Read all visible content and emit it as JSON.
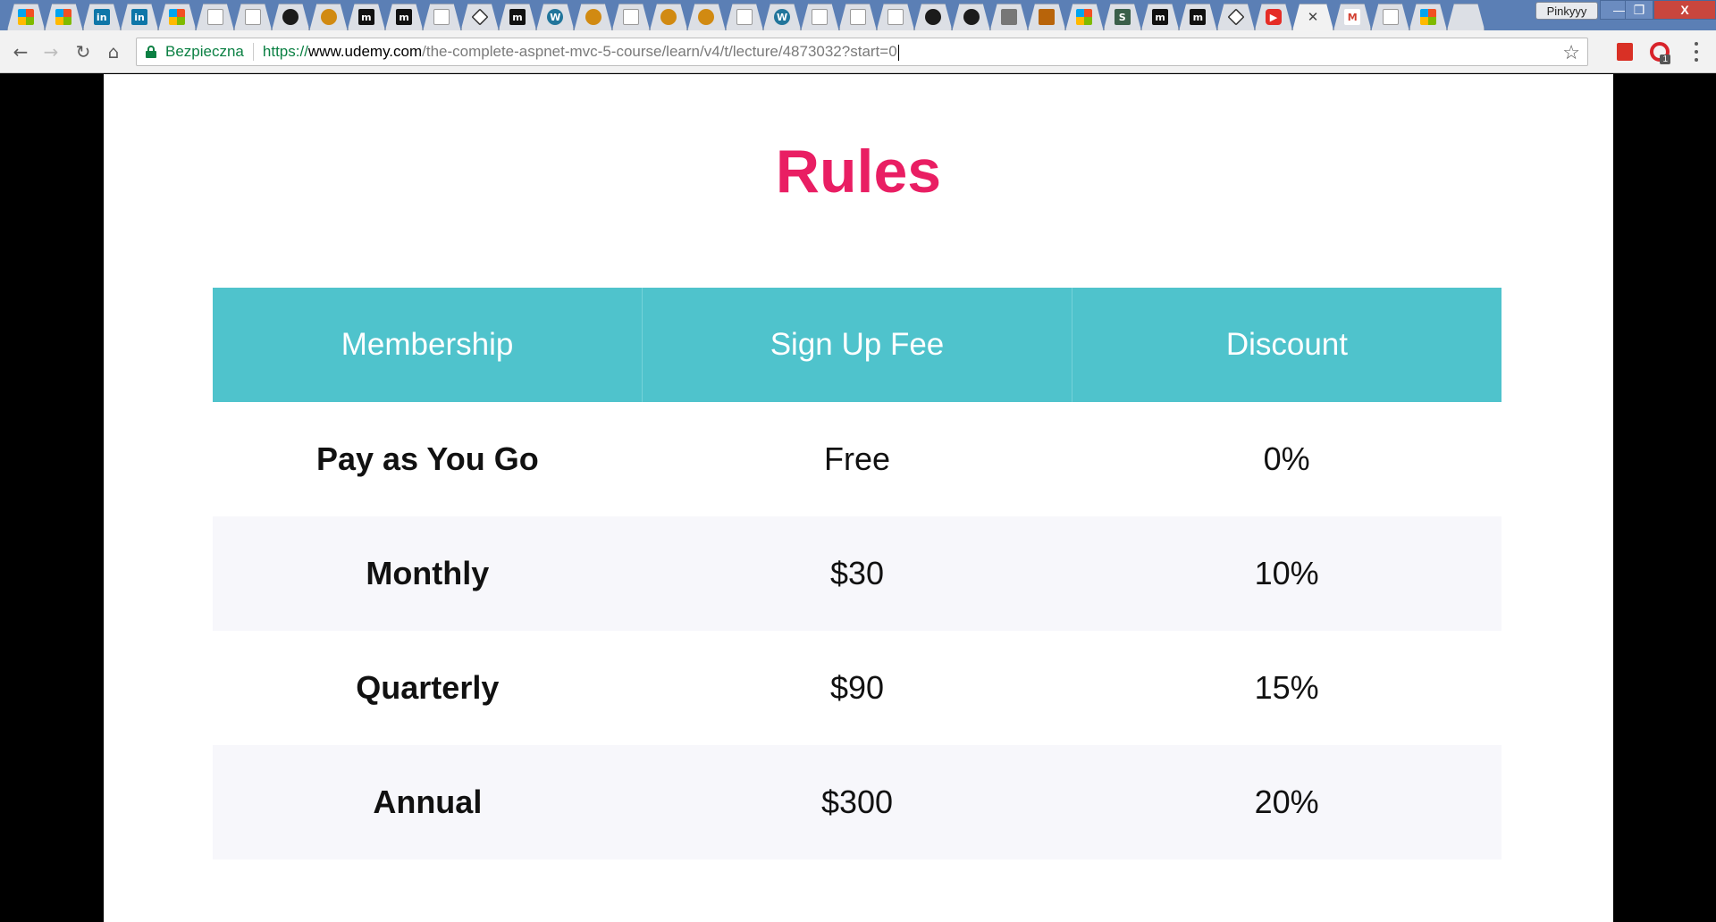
{
  "browser": {
    "tabs": [
      {
        "icon": "microsoft-icon",
        "glyph": ""
      },
      {
        "icon": "microsoft-icon",
        "glyph": ""
      },
      {
        "icon": "linkedin-icon",
        "glyph": "in"
      },
      {
        "icon": "linkedin-icon",
        "glyph": "in"
      },
      {
        "icon": "microsoft-icon",
        "glyph": ""
      },
      {
        "icon": "document-icon",
        "glyph": ""
      },
      {
        "icon": "document-icon",
        "glyph": ""
      },
      {
        "icon": "github-icon",
        "glyph": ""
      },
      {
        "icon": "lion-icon",
        "glyph": ""
      },
      {
        "icon": "m-icon",
        "glyph": "m"
      },
      {
        "icon": "m-icon",
        "glyph": "m"
      },
      {
        "icon": "document-icon",
        "glyph": ""
      },
      {
        "icon": "diamond-icon",
        "glyph": ""
      },
      {
        "icon": "m-icon",
        "glyph": "m"
      },
      {
        "icon": "wordpress-icon",
        "glyph": "W"
      },
      {
        "icon": "lion-icon",
        "glyph": ""
      },
      {
        "icon": "document-icon",
        "glyph": ""
      },
      {
        "icon": "lion-icon",
        "glyph": ""
      },
      {
        "icon": "lion-icon",
        "glyph": ""
      },
      {
        "icon": "document-icon",
        "glyph": ""
      },
      {
        "icon": "wordpress-icon",
        "glyph": "W"
      },
      {
        "icon": "document-icon",
        "glyph": ""
      },
      {
        "icon": "document-icon",
        "glyph": ""
      },
      {
        "icon": "cake-icon",
        "glyph": ""
      },
      {
        "icon": "github-icon",
        "glyph": ""
      },
      {
        "icon": "github-icon",
        "glyph": ""
      },
      {
        "icon": "gray-grid-icon",
        "glyph": ""
      },
      {
        "icon": "gold-icon",
        "glyph": ""
      },
      {
        "icon": "microsoft-icon",
        "glyph": ""
      },
      {
        "icon": "s-icon",
        "glyph": "S"
      },
      {
        "icon": "m-icon",
        "glyph": "m"
      },
      {
        "icon": "m-icon",
        "glyph": "m"
      },
      {
        "icon": "diamond-icon",
        "glyph": ""
      },
      {
        "icon": "youtube-icon",
        "glyph": "▶"
      },
      {
        "icon": "close-icon",
        "glyph": "✕",
        "active": true
      },
      {
        "icon": "gmail-icon",
        "glyph": "M"
      },
      {
        "icon": "cloud-icon",
        "glyph": ""
      },
      {
        "icon": "microsoft-icon",
        "glyph": ""
      },
      {
        "icon": "new-tab-icon",
        "glyph": ""
      }
    ],
    "profile_name": "Pinkyyy",
    "window_controls": {
      "minimize": "—",
      "maximize": "❐",
      "close": "X"
    },
    "nav": {
      "back": "←",
      "forward": "→",
      "reload": "↻",
      "home": "⌂"
    },
    "security_label": "Bezpieczna",
    "url": {
      "scheme": "https://",
      "host": "www.udemy.com",
      "path": "/the-complete-aspnet-mvc-5-course/learn/v4/t/lecture/4873032?start=0"
    },
    "bookmark_star": "☆",
    "extensions": {
      "opera_count": "1"
    }
  },
  "slide": {
    "title": "Rules",
    "table": {
      "headers": [
        "Membership",
        "Sign Up Fee",
        "Discount"
      ],
      "rows": [
        [
          "Pay as You Go",
          "Free",
          "0%"
        ],
        [
          "Monthly",
          "$30",
          "10%"
        ],
        [
          "Quarterly",
          "$90",
          "15%"
        ],
        [
          "Annual",
          "$300",
          "20%"
        ]
      ]
    },
    "colors": {
      "title": "#e91e63",
      "header_bg": "#4fc3cc",
      "alt_row": "#f7f7fb"
    }
  }
}
